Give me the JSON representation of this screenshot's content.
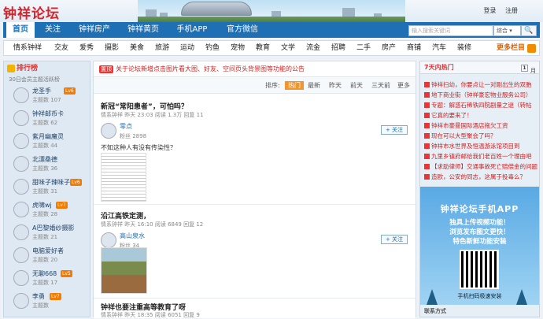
{
  "site": {
    "logo": "钟祥论坛",
    "login": "登录",
    "register": "注册"
  },
  "nav": {
    "items": [
      "首页",
      "关注",
      "钟祥房产",
      "钟祥黄页",
      "手机APP",
      "官方微信"
    ],
    "active": 0
  },
  "search": {
    "placeholder": "输入搜索关键词",
    "scope": "综合",
    "button": "🔍"
  },
  "cats": {
    "items": [
      "情系钟祥",
      "交友",
      "爱秀",
      "摄影",
      "美食",
      "旅游",
      "运动",
      "钓鱼",
      "宠物",
      "教育",
      "文学",
      "流金",
      "招聘",
      "二手",
      "房产",
      "商铺",
      "汽车",
      "装修"
    ],
    "more": "更多栏目"
  },
  "sidebar": {
    "title": "排行榜",
    "subtitle": "30日会员主题活跃榜",
    "users": [
      {
        "name": "龙圣手",
        "tag": "Lv6",
        "stat": "主题数 107"
      },
      {
        "name": "钟祥邮币卡",
        "tag": "",
        "stat": "主题数 62"
      },
      {
        "name": "紫月幽魔灵",
        "tag": "",
        "stat": "主题数 44"
      },
      {
        "name": "北漂桑德",
        "tag": "",
        "stat": "主题数 36"
      },
      {
        "name": "甜味子辣味子",
        "tag": "Lv6",
        "stat": "主题数 31"
      },
      {
        "name": "虎啸wj",
        "tag": "Lv7",
        "stat": "主题数 28"
      },
      {
        "name": "A巴黎婚纱摄影",
        "tag": "",
        "stat": "主题数 21"
      },
      {
        "name": "电脑爱好者",
        "tag": "",
        "stat": "主题数 20"
      },
      {
        "name": "无聊668",
        "tag": "Lv5",
        "stat": "主题数 17"
      },
      {
        "name": "李勇",
        "tag": "Lv7",
        "stat": "主题数"
      }
    ]
  },
  "notice": {
    "tag": "置顶",
    "text": "关于论坛新增点击图片看大图、好友、空间页头背景图等功能的公告"
  },
  "sort": {
    "label": "排序:",
    "items": [
      "热门",
      "最新",
      "昨天",
      "前天",
      "三天前",
      "更多"
    ]
  },
  "posts": [
    {
      "title": "新冠“常阳患者”，可怕吗？",
      "meta": "情系钟祥   昨天 23:03   阅读 1.3万   回复 11",
      "author": "零点",
      "fans": "粉丝 2898",
      "follow": "+ 关注",
      "text": "不知这种人有没有传染性？"
    },
    {
      "title": "沿江高铁定测，",
      "meta": "情系钟祥   昨天 16:10   阅读 6849   回复 12",
      "author": "高山泉水",
      "fans": "粉丝 34",
      "follow": "+ 关注",
      "text": ""
    },
    {
      "title": "钟祥也要注重高等教育了呀",
      "meta": "情系钟祥   昨天 18:35   阅读 6051   回复 9",
      "author": "",
      "fans": "",
      "follow": "",
      "text": ""
    }
  ],
  "hot": {
    "title": "7天内热门",
    "page": "1",
    "unit": "月",
    "items": [
      "钟祥扫幼，你要点让一对刚出生的双胞",
      "地下商业街（钟祥豪宏物业服务公司）",
      "专题：解惑石稀铁四院剧量之谜（转帖",
      "它真的要来了！",
      "钟祥市豪曼国际酒店拖欠工资",
      "现在可以大型聚会了吗？",
      "钟祥市水世界及恒温游泳馆项目到",
      "九里乡镇府邮给我们老百姓一个理由吧",
      "【求助律师】交通事故死亡赔偿金的问题",
      "造欧，公安的同志，这属于投毒么？"
    ]
  },
  "ad": {
    "line1": "钟祥论坛手机APP",
    "line2": "独具上传视频功能！",
    "line3": "浏览发布图文更快！",
    "line4": "特色新鲜功能安装",
    "caption": "手机扫码极速安装"
  },
  "footer": {
    "contact": "联系方式"
  }
}
